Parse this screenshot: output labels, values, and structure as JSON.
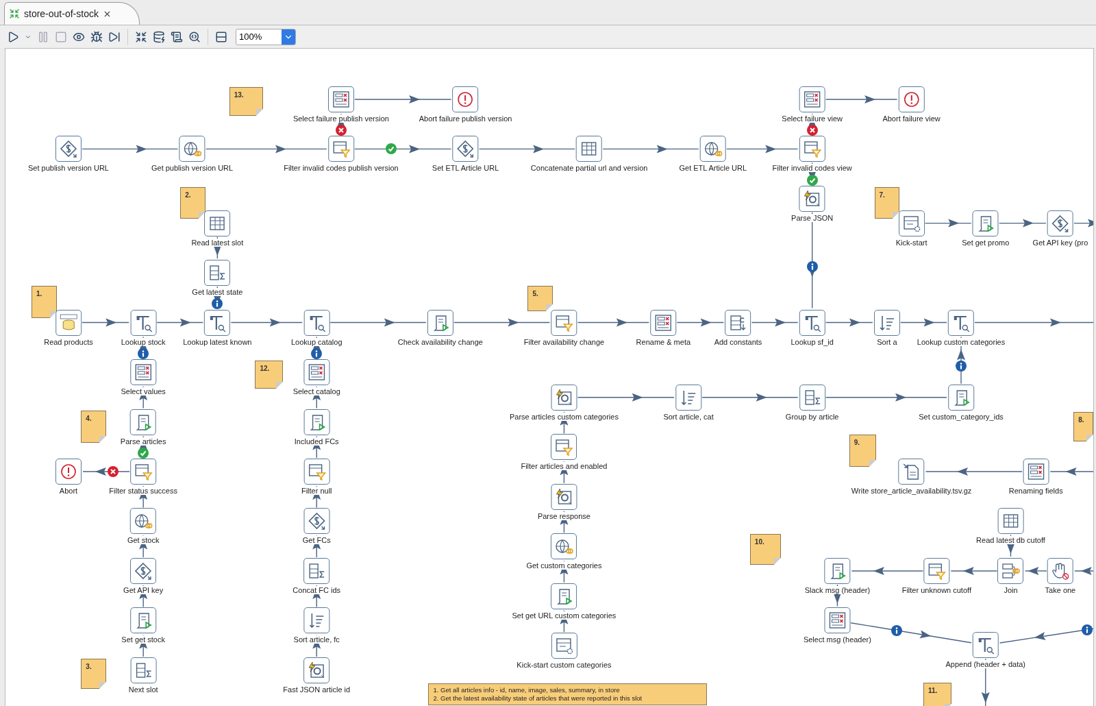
{
  "tab": {
    "title": "store-out-of-stock",
    "selected": true
  },
  "toolbar": {
    "zoom": "100%"
  },
  "steps": [
    {
      "label": "Select failure publish version",
      "kind": "fields"
    },
    {
      "label": "Abort failure publish version",
      "kind": "abort"
    },
    {
      "label": "Select failure view",
      "kind": "fields"
    },
    {
      "label": "Abort failure view",
      "kind": "abort"
    },
    {
      "label": "Set publish version URL",
      "kind": "dollar"
    },
    {
      "label": "Get publish version URL",
      "kind": "rest"
    },
    {
      "label": "Filter invalid codes publish version",
      "kind": "filter"
    },
    {
      "label": "Set ETL Article URL",
      "kind": "dollar"
    },
    {
      "label": "Concatenate partial url and version",
      "kind": "table"
    },
    {
      "label": "Get ETL Article URL",
      "kind": "rest"
    },
    {
      "label": "Filter invalid codes view",
      "kind": "filter"
    },
    {
      "label": "Parse JSON",
      "kind": "json"
    },
    {
      "label": "Read latest slot",
      "kind": "table"
    },
    {
      "label": "Kick-start",
      "kind": "generator"
    },
    {
      "label": "Set get promo",
      "kind": "js"
    },
    {
      "label": "Get API key (pro",
      "kind": "dollar"
    },
    {
      "label": "Get latest state",
      "kind": "groupby"
    },
    {
      "label": "Read products",
      "kind": "mongo"
    },
    {
      "label": "Lookup stock",
      "kind": "lookup"
    },
    {
      "label": "Lookup latest known",
      "kind": "lookup"
    },
    {
      "label": "Lookup catalog",
      "kind": "lookup"
    },
    {
      "label": "Check availability change",
      "kind": "js"
    },
    {
      "label": "Filter availability change",
      "kind": "filter"
    },
    {
      "label": "Rename & meta",
      "kind": "fields"
    },
    {
      "label": "Add constants",
      "kind": "constants"
    },
    {
      "label": "Lookup sf_id",
      "kind": "lookup"
    },
    {
      "label": "Sort a",
      "kind": "sort"
    },
    {
      "label": "Lookup custom categories",
      "kind": "lookup"
    },
    {
      "label": "Select values",
      "kind": "fields"
    },
    {
      "label": "Parse articles",
      "kind": "js"
    },
    {
      "label": "Abort",
      "kind": "abort"
    },
    {
      "label": "Filter status success",
      "kind": "filter"
    },
    {
      "label": "Get stock",
      "kind": "rest"
    },
    {
      "label": "Get API key",
      "kind": "dollar"
    },
    {
      "label": "Set get stock",
      "kind": "js"
    },
    {
      "label": "Next slot",
      "kind": "groupby"
    },
    {
      "label": "Select catalog",
      "kind": "fields"
    },
    {
      "label": "Included FCs",
      "kind": "js"
    },
    {
      "label": "Filter null",
      "kind": "filter"
    },
    {
      "label": "Get FCs",
      "kind": "dollar"
    },
    {
      "label": "Concat FC ids",
      "kind": "groupby"
    },
    {
      "label": "Sort article, fc",
      "kind": "sort"
    },
    {
      "label": "Fast JSON article id",
      "kind": "json"
    },
    {
      "label": "Parse articles custom categories",
      "kind": "json"
    },
    {
      "label": "Sort article, cat",
      "kind": "sort"
    },
    {
      "label": "Group by article",
      "kind": "groupby"
    },
    {
      "label": "Set custom_category_ids",
      "kind": "js"
    },
    {
      "label": "Filter articles and enabled",
      "kind": "filter"
    },
    {
      "label": "Parse response",
      "kind": "json"
    },
    {
      "label": "Get custom categories",
      "kind": "rest"
    },
    {
      "label": "Set get URL custom categories",
      "kind": "js"
    },
    {
      "label": "Kick-start custom categories",
      "kind": "generator"
    },
    {
      "label": "Write store_article_availability.tsv.gz",
      "kind": "file"
    },
    {
      "label": "Renaming fields",
      "kind": "fields"
    },
    {
      "label": "Read latest db cutoff",
      "kind": "table"
    },
    {
      "label": "Slack msg (header)",
      "kind": "js"
    },
    {
      "label": "Filter unknown cutoff",
      "kind": "filter"
    },
    {
      "label": "Join",
      "kind": "join"
    },
    {
      "label": "Take one",
      "kind": "hand"
    },
    {
      "label": "Select msg (header)",
      "kind": "fields"
    },
    {
      "label": "Append (header + data)",
      "kind": "lookup"
    }
  ],
  "notes": [
    {
      "text": "13."
    },
    {
      "text": "2."
    },
    {
      "text": "7."
    },
    {
      "text": "1."
    },
    {
      "text": "5."
    },
    {
      "text": "12."
    },
    {
      "text": "4."
    },
    {
      "text": "9."
    },
    {
      "text": "8."
    },
    {
      "text": "10."
    },
    {
      "text": "3."
    },
    {
      "text": "11."
    }
  ],
  "comment": {
    "lines": [
      "1. Get all articles info - id, name, image, sales, summary, in store",
      "2. Get the latest availability state of articles that were reported in this slot"
    ]
  }
}
